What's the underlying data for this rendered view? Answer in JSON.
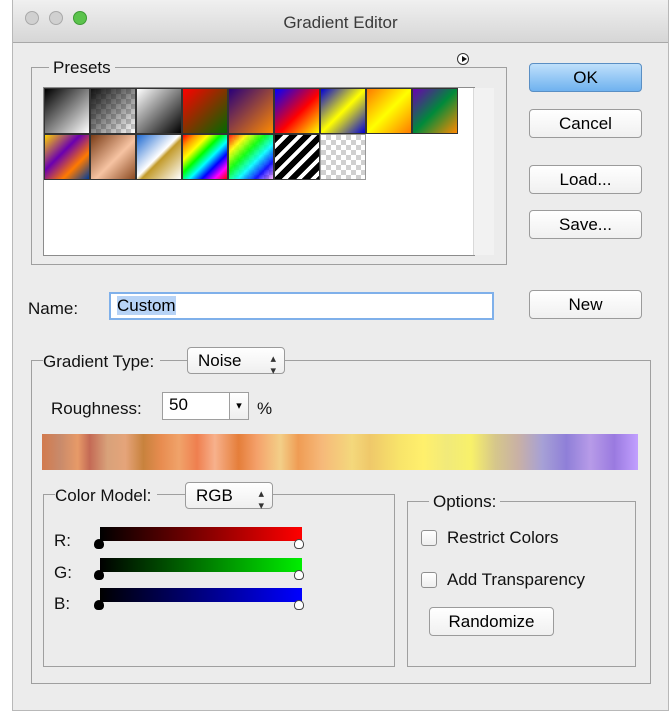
{
  "window": {
    "title": "Gradient Editor"
  },
  "presets": {
    "legend": "Presets",
    "menu_icon": "circle-arrow-right-icon",
    "swatches": [
      {
        "name": "black-white"
      },
      {
        "name": "transparent-checker"
      },
      {
        "name": "black-white-2"
      },
      {
        "name": "red-green"
      },
      {
        "name": "violet-orange"
      },
      {
        "name": "blue-red-yellow"
      },
      {
        "name": "blue-yellow-blue"
      },
      {
        "name": "orange-yellow-orange"
      },
      {
        "name": "violet-green-orange"
      },
      {
        "name": "yellow-violet-orange-blue"
      },
      {
        "name": "copper"
      },
      {
        "name": "chrome"
      },
      {
        "name": "spectrum"
      },
      {
        "name": "transparent-rainbow"
      },
      {
        "name": "transparent-stripes"
      },
      {
        "name": "transparent"
      }
    ]
  },
  "buttons": {
    "ok": "OK",
    "cancel": "Cancel",
    "load": "Load...",
    "save": "Save...",
    "new": "New",
    "randomize": "Randomize"
  },
  "name_field": {
    "label": "Name:",
    "value": "Custom"
  },
  "gradient": {
    "type_label": "Gradient Type:",
    "type_value": "Noise",
    "roughness_label": "Roughness:",
    "roughness_value": "50",
    "roughness_unit": "%"
  },
  "color_model": {
    "label": "Color Model:",
    "value": "RGB",
    "channels": [
      {
        "label": "R:",
        "color": "#ff0000",
        "min": 0,
        "max": 100
      },
      {
        "label": "G:",
        "color": "#00ee00",
        "min": 0,
        "max": 100
      },
      {
        "label": "B:",
        "color": "#0000ff",
        "min": 0,
        "max": 100
      }
    ]
  },
  "options": {
    "legend": "Options:",
    "restrict_colors": "Restrict Colors",
    "add_transparency": "Add Transparency"
  },
  "colors": {
    "accent": "#6fb2ef"
  }
}
